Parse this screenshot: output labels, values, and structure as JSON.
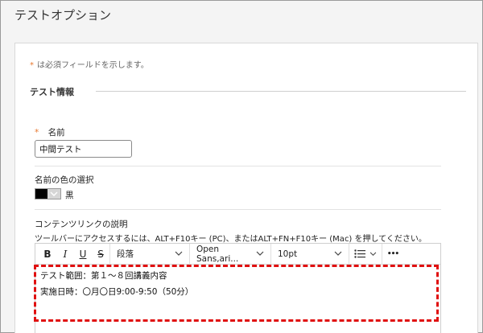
{
  "page": {
    "title": "テストオプション"
  },
  "form": {
    "required_star": "*",
    "required_note": "は必須フィールドを示します。",
    "section_title": "テスト情報",
    "name": {
      "star": "*",
      "label": "名前",
      "value": "中間テスト"
    },
    "color": {
      "label": "名前の色の選択",
      "value_name": "黒",
      "swatch": "#000000"
    },
    "description": {
      "label": "コンテンツリンクの説明",
      "help": "ツールバーにアクセスするには、ALT+F10キー (PC)、またはALT+FN+F10キー (Mac) を押してください。"
    }
  },
  "toolbar": {
    "bold": "B",
    "italic": "I",
    "underline": "U",
    "strike": "S",
    "paragraph": "段落",
    "font": "Open Sans,ari...",
    "size": "10pt",
    "more": "•••"
  },
  "editor": {
    "lines": [
      "テスト範囲：第１～８回講義内容",
      "実施日時：〇月〇日9:00-9:50（50分）"
    ]
  },
  "colors": {
    "accent_star": "#e8782f",
    "highlight": "#e01010"
  }
}
